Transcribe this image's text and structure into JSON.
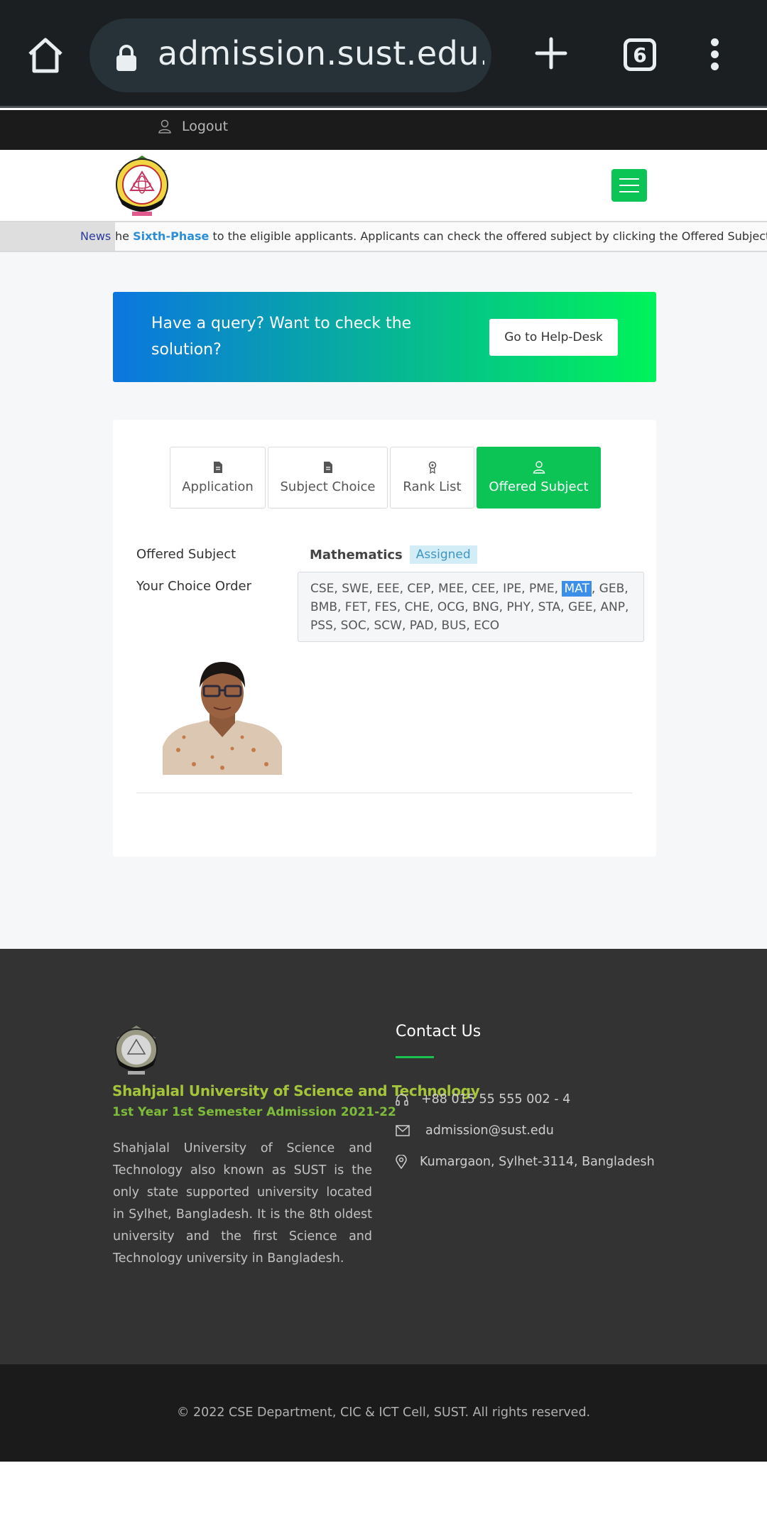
{
  "browser": {
    "url": "admission.sust.edu.bd/",
    "tab_count": "6"
  },
  "top_bar": {
    "logout_label": "Logout"
  },
  "news": {
    "label": "News",
    "text_before": "he ",
    "highlight": "Sixth-Phase",
    "text_after": " to the eligible applicants. Applicants can check the offered subject by clicking the Offered Subject tab af"
  },
  "help_banner": {
    "text": "Have a query? Want to check the solution?",
    "button_label": "Go to Help-Desk"
  },
  "tabs": [
    {
      "label": "Application"
    },
    {
      "label": "Subject Choice"
    },
    {
      "label": "Rank List"
    },
    {
      "label": "Offered Subject"
    }
  ],
  "result": {
    "offered_label": "Offered Subject",
    "offered_subject": "Mathematics",
    "status_badge": "Assigned",
    "choice_label": "Your Choice Order",
    "choice_before": "CSE, SWE, EEE, CEP, MEE, CEE, IPE, PME, ",
    "choice_highlight": "MAT",
    "choice_after": ", GEB, BMB, FET, FES, CHE, OCG, BNG, PHY, STA, GEE, ANP, PSS, SOC, SCW, PAD, BUS, ECO"
  },
  "footer": {
    "university_name": "Shahjalal University of Science and Technology",
    "admission_title": "1st Year 1st Semester Admission 2021-22",
    "description": "Shahjalal University of Science and Technology also known as SUST is the only state supported university located in Sylhet, Bangladesh. It is the 8th oldest university and the first Science and Technology university in Bangladesh.",
    "contact_title": "Contact Us",
    "phone": "+88 015 55 555 002 - 4",
    "email": "admission@sust.edu",
    "address": "Kumargaon, Sylhet-3114, Bangladesh",
    "copyright": "© 2022 CSE Department, CIC & ICT Cell, SUST. All rights reserved."
  },
  "colors": {
    "accent_green": "#0cc455",
    "badge_bg": "#d3edf6",
    "highlight_blue": "#3b8fe8"
  },
  "icons": [
    "home-icon",
    "lock-icon",
    "plus-icon",
    "tabs-icon",
    "more-vert-icon",
    "user-icon",
    "menu-icon",
    "document-icon",
    "award-icon",
    "headphones-icon",
    "mail-icon",
    "location-pin-icon"
  ]
}
